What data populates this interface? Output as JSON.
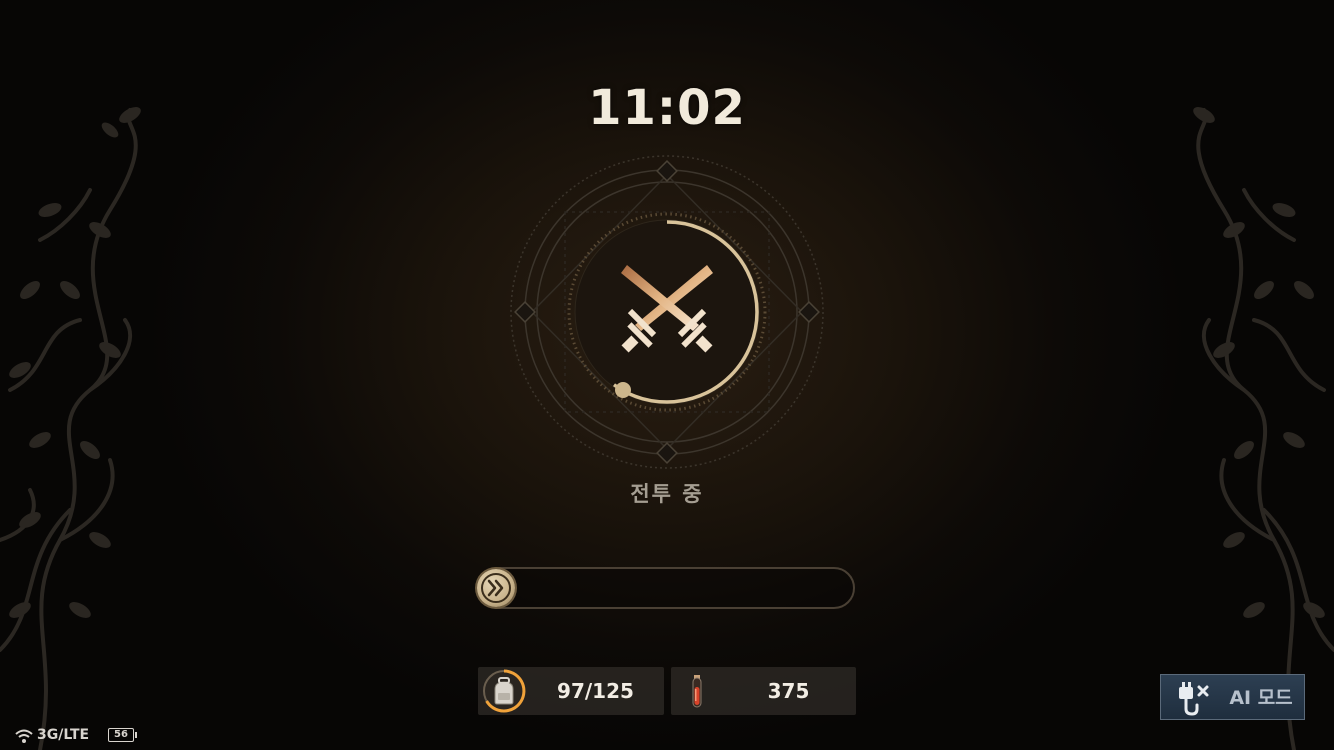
{
  "clock": {
    "time": "11:02"
  },
  "battle": {
    "status_label": "전투 중",
    "emblem_icon": "crossed-swords-icon",
    "ring_progress_fraction": 0.6
  },
  "fast_forward": {
    "icon": "fast-forward-icon",
    "progress_fraction": 0.0
  },
  "stats": {
    "bag": {
      "icon": "backpack-icon",
      "value": "97/125"
    },
    "potion": {
      "icon": "red-potion-icon",
      "value": "375"
    }
  },
  "ai_mode": {
    "icon": "unplugged-icon",
    "label": "AI 모드"
  },
  "device_status": {
    "network": "3G/LTE",
    "battery": "56"
  },
  "colors": {
    "accent_gold": "#c8b28a",
    "text_light": "#f1eadb",
    "ai_button_bg": "#2d3f52"
  }
}
